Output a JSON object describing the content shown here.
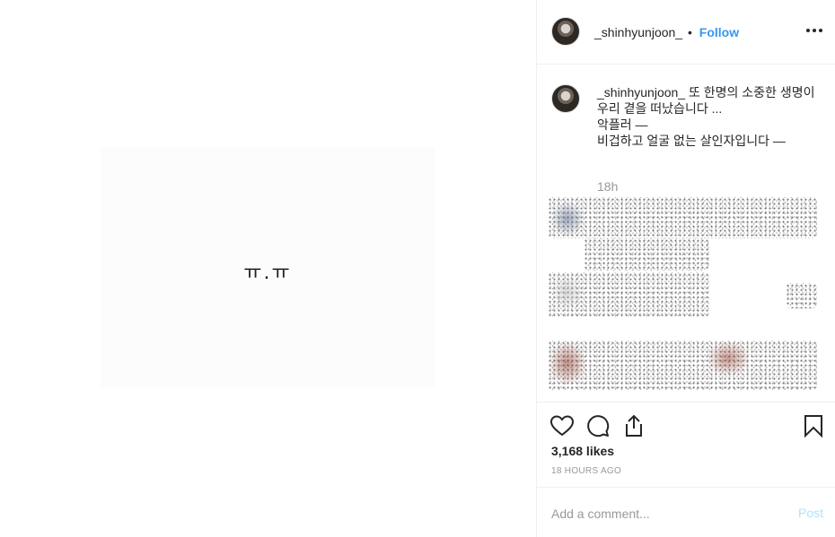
{
  "media": {
    "text": "ㅠ.ㅠ"
  },
  "header": {
    "username": "_shinhyunjoon_",
    "separator": "•",
    "follow_label": "Follow"
  },
  "caption": {
    "username": "_shinhyunjoon_",
    "lines": [
      "또 한명의 소중한 생명이",
      "우리 곁을 떠났습니다 ...",
      "악플러 —",
      "비겁하고 얼굴 없는 살인자입니다 —"
    ],
    "time": "18h"
  },
  "likes": "3,168 likes",
  "timestamp": "18 HOURS AGO",
  "comment": {
    "placeholder": "Add a comment...",
    "post_label": "Post"
  },
  "icons": [
    "heart-icon",
    "comment-icon",
    "share-icon",
    "bookmark-icon",
    "more-icon"
  ],
  "colors": {
    "accent": "#3897f0",
    "post_disabled": "#b2dffc",
    "muted": "#999999"
  }
}
